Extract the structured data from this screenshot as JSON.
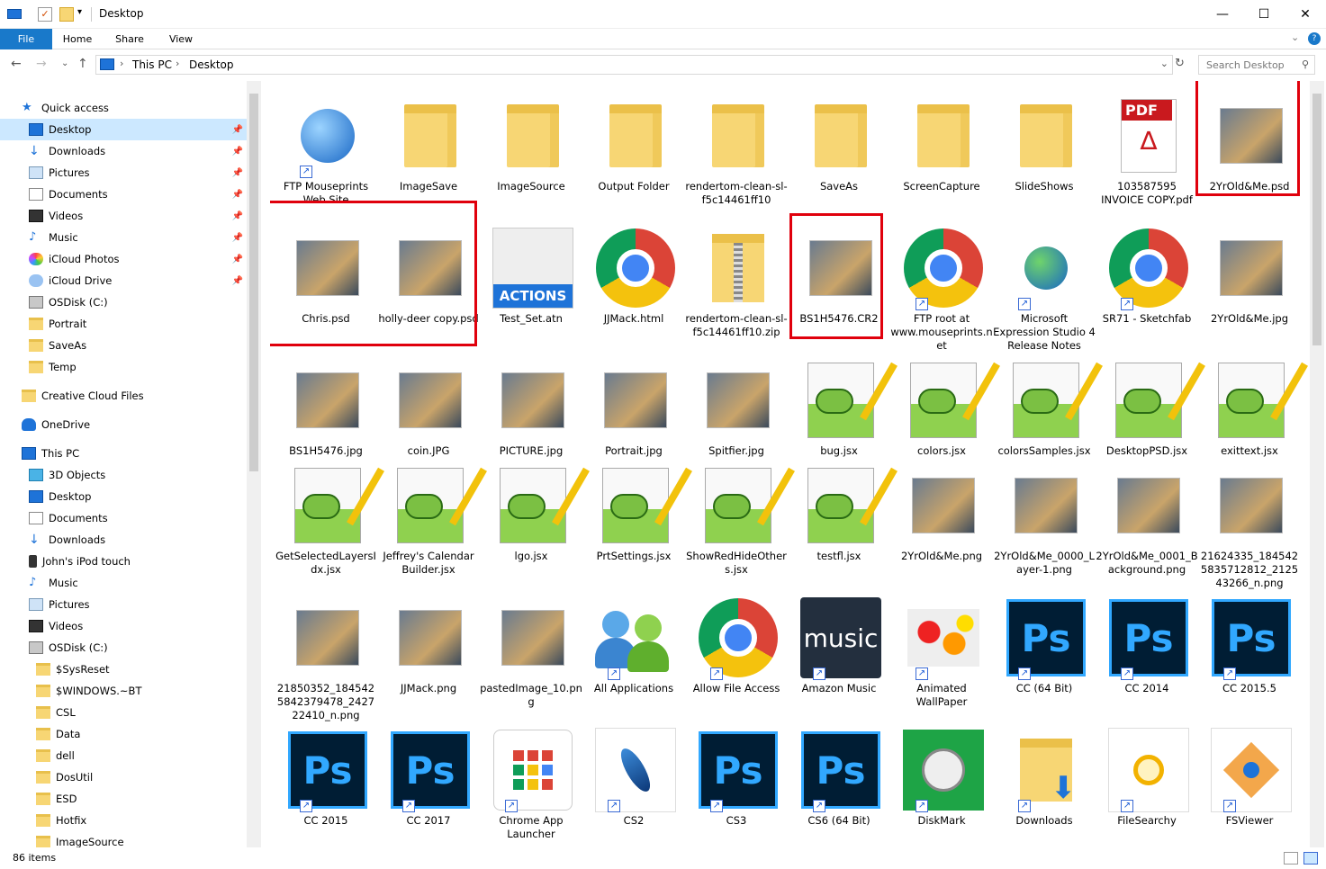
{
  "window": {
    "title": "Desktop",
    "minimize": "—",
    "maximize": "☐",
    "close": "✕"
  },
  "ribbon": {
    "tabs": [
      "File",
      "Home",
      "Share",
      "View"
    ]
  },
  "address": {
    "crumbs": [
      "This PC",
      "Desktop"
    ]
  },
  "search": {
    "placeholder": "Search Desktop"
  },
  "nav": {
    "items": [
      {
        "label": "Quick access",
        "icon": "star-icon",
        "pin": false
      },
      {
        "label": "Desktop",
        "icon": "desktop-icon",
        "pin": true,
        "selected": true
      },
      {
        "label": "Downloads",
        "icon": "download-icon",
        "pin": true
      },
      {
        "label": "Pictures",
        "icon": "pictures-icon",
        "pin": true
      },
      {
        "label": "Documents",
        "icon": "documents-icon",
        "pin": true
      },
      {
        "label": "Videos",
        "icon": "videos-icon",
        "pin": true
      },
      {
        "label": "Music",
        "icon": "music-icon",
        "pin": true
      },
      {
        "label": "iCloud Photos",
        "icon": "icloud-photos-icon",
        "pin": true
      },
      {
        "label": "iCloud Drive",
        "icon": "icloud-drive-icon",
        "pin": true
      },
      {
        "label": "OSDisk (C:)",
        "icon": "disk-icon",
        "pin": false
      },
      {
        "label": "Portrait",
        "icon": "folder-icon",
        "pin": false
      },
      {
        "label": "SaveAs",
        "icon": "folder-icon",
        "pin": false
      },
      {
        "label": "Temp",
        "icon": "folder-icon",
        "pin": false
      },
      {
        "label": "Creative Cloud Files",
        "icon": "folder-icon",
        "pin": false
      },
      {
        "label": "OneDrive",
        "icon": "onedrive-icon",
        "pin": false
      },
      {
        "label": "This PC",
        "icon": "pc-icon",
        "pin": false
      },
      {
        "label": "3D Objects",
        "icon": "3d-icon",
        "pin": false
      },
      {
        "label": "Desktop",
        "icon": "desktop-icon",
        "pin": false
      },
      {
        "label": "Documents",
        "icon": "documents-icon",
        "pin": false
      },
      {
        "label": "Downloads",
        "icon": "download-icon",
        "pin": false
      },
      {
        "label": "John's iPod touch",
        "icon": "ipod-icon",
        "pin": false
      },
      {
        "label": "Music",
        "icon": "music-icon",
        "pin": false
      },
      {
        "label": "Pictures",
        "icon": "pictures-icon",
        "pin": false
      },
      {
        "label": "Videos",
        "icon": "videos-icon",
        "pin": false
      },
      {
        "label": "OSDisk (C:)",
        "icon": "disk-icon",
        "pin": false
      },
      {
        "label": "$SysReset",
        "icon": "folder-icon",
        "pin": false
      },
      {
        "label": "$WINDOWS.~BT",
        "icon": "folder-icon",
        "pin": false
      },
      {
        "label": "CSL",
        "icon": "folder-icon",
        "pin": false
      },
      {
        "label": "Data",
        "icon": "folder-icon",
        "pin": false
      },
      {
        "label": "dell",
        "icon": "folder-icon",
        "pin": false
      },
      {
        "label": "DosUtil",
        "icon": "folder-icon",
        "pin": false
      },
      {
        "label": "ESD",
        "icon": "folder-icon",
        "pin": false
      },
      {
        "label": "Hotfix",
        "icon": "folder-icon",
        "pin": false
      },
      {
        "label": "ImageSource",
        "icon": "folder-icon",
        "pin": false
      }
    ]
  },
  "files": [
    {
      "name": "FTP Mouseprints Web Site",
      "icon": "globe-network-icon",
      "shortcut": true
    },
    {
      "name": "ImageSave",
      "icon": "folder-icon",
      "shortcut": false
    },
    {
      "name": "ImageSource",
      "icon": "folder-icon",
      "shortcut": false
    },
    {
      "name": "Output Folder",
      "icon": "folder-icon",
      "shortcut": false
    },
    {
      "name": "rendertom-clean-sl-f5c14461ff10",
      "icon": "folder-icon",
      "shortcut": false
    },
    {
      "name": "SaveAs",
      "icon": "folder-icon",
      "shortcut": false
    },
    {
      "name": "ScreenCapture",
      "icon": "folder-icon",
      "shortcut": false
    },
    {
      "name": "SlideShows",
      "icon": "folder-icon",
      "shortcut": false
    },
    {
      "name": "103587595 INVOICE COPY.pdf",
      "icon": "pdf-icon",
      "shortcut": false
    },
    {
      "name": "2YrOld&Me.psd",
      "icon": "image-thumbnail",
      "shortcut": false
    },
    {
      "name": "Chris.psd",
      "icon": "image-thumbnail",
      "shortcut": false
    },
    {
      "name": "holly-deer copy.psd",
      "icon": "image-thumbnail",
      "shortcut": false
    },
    {
      "name": "Test_Set.atn",
      "icon": "actions-icon",
      "shortcut": false
    },
    {
      "name": "JJMack.html",
      "icon": "chrome-icon",
      "shortcut": false
    },
    {
      "name": "rendertom-clean-sl-f5c14461ff10.zip",
      "icon": "zip-icon",
      "shortcut": false
    },
    {
      "name": "BS1H5476.CR2",
      "icon": "image-thumbnail",
      "shortcut": false
    },
    {
      "name": "FTP root at www.mouseprints.net",
      "icon": "chrome-icon",
      "shortcut": true
    },
    {
      "name": "Microsoft Expression Studio 4 Release Notes",
      "icon": "globe-icon",
      "shortcut": true
    },
    {
      "name": "SR71 - Sketchfab",
      "icon": "chrome-icon",
      "shortcut": true
    },
    {
      "name": "2YrOld&Me.jpg",
      "icon": "image-thumbnail",
      "shortcut": false
    },
    {
      "name": "BS1H5476.jpg",
      "icon": "image-thumbnail",
      "shortcut": false
    },
    {
      "name": "coin.JPG",
      "icon": "image-thumbnail",
      "shortcut": false
    },
    {
      "name": "PICTURE.jpg",
      "icon": "image-thumbnail",
      "shortcut": false
    },
    {
      "name": "Portrait.jpg",
      "icon": "image-thumbnail",
      "shortcut": false
    },
    {
      "name": "Spitfier.jpg",
      "icon": "image-thumbnail",
      "shortcut": false
    },
    {
      "name": "bug.jsx",
      "icon": "notepad-plus-icon",
      "shortcut": false
    },
    {
      "name": "colors.jsx",
      "icon": "notepad-plus-icon",
      "shortcut": false
    },
    {
      "name": "colorsSamples.jsx",
      "icon": "notepad-plus-icon",
      "shortcut": false
    },
    {
      "name": "DesktopPSD.jsx",
      "icon": "notepad-plus-icon",
      "shortcut": false
    },
    {
      "name": "exittext.jsx",
      "icon": "notepad-plus-icon",
      "shortcut": false
    },
    {
      "name": "GetSelectedLayersIdx.jsx",
      "icon": "notepad-plus-icon",
      "shortcut": false
    },
    {
      "name": "Jeffrey's Calendar Builder.jsx",
      "icon": "notepad-plus-icon",
      "shortcut": false
    },
    {
      "name": "lgo.jsx",
      "icon": "notepad-plus-icon",
      "shortcut": false
    },
    {
      "name": "PrtSettings.jsx",
      "icon": "notepad-plus-icon",
      "shortcut": false
    },
    {
      "name": "ShowRedHideOthers.jsx",
      "icon": "notepad-plus-icon",
      "shortcut": false
    },
    {
      "name": "testfl.jsx",
      "icon": "notepad-plus-icon",
      "shortcut": false
    },
    {
      "name": "2YrOld&Me.png",
      "icon": "image-thumbnail",
      "shortcut": false
    },
    {
      "name": "2YrOld&Me_0000_Layer-1.png",
      "icon": "image-thumbnail",
      "shortcut": false
    },
    {
      "name": "2YrOld&Me_0001_Background.png",
      "icon": "image-thumbnail",
      "shortcut": false
    },
    {
      "name": "21624335_1845425835712812_212543266_n.png",
      "icon": "image-thumbnail",
      "shortcut": false
    },
    {
      "name": "21850352_1845425842379478_242722410_n.png",
      "icon": "image-thumbnail",
      "shortcut": false
    },
    {
      "name": "JJMack.png",
      "icon": "image-thumbnail",
      "shortcut": false
    },
    {
      "name": "pastedImage_10.png",
      "icon": "image-thumbnail",
      "shortcut": false
    },
    {
      "name": "All Applications",
      "icon": "users-icon",
      "shortcut": true
    },
    {
      "name": "Allow File Access",
      "icon": "chrome-icon",
      "shortcut": true
    },
    {
      "name": "Amazon Music",
      "icon": "amazon-music-icon",
      "shortcut": true
    },
    {
      "name": "Animated WallPaper",
      "icon": "flowers-icon",
      "shortcut": true
    },
    {
      "name": "CC (64 Bit)",
      "icon": "photoshop-icon",
      "shortcut": true
    },
    {
      "name": "CC 2014",
      "icon": "photoshop-icon",
      "shortcut": true
    },
    {
      "name": "CC 2015.5",
      "icon": "photoshop-icon",
      "shortcut": true
    },
    {
      "name": "CC 2015",
      "icon": "photoshop-icon",
      "shortcut": true
    },
    {
      "name": "CC 2017",
      "icon": "photoshop-icon",
      "shortcut": true
    },
    {
      "name": "Chrome App Launcher",
      "icon": "app-launcher-icon",
      "shortcut": true
    },
    {
      "name": "CS2",
      "icon": "feather-icon",
      "shortcut": true
    },
    {
      "name": "CS3",
      "icon": "photoshop-icon",
      "shortcut": true
    },
    {
      "name": "CS6 (64 Bit)",
      "icon": "photoshop-icon",
      "shortcut": true
    },
    {
      "name": "DiskMark",
      "icon": "diskmark-icon",
      "shortcut": true
    },
    {
      "name": "Downloads",
      "icon": "downloads-folder-icon",
      "shortcut": true
    },
    {
      "name": "FileSearchy",
      "icon": "search-file-icon",
      "shortcut": true
    },
    {
      "name": "FSViewer",
      "icon": "eye-icon",
      "shortcut": true
    }
  ],
  "highlights": [
    "2YrOld&Me.psd",
    "Chris.psd / holly-deer copy.psd",
    "BS1H5476.CR2"
  ],
  "status": {
    "count": "86 items"
  }
}
